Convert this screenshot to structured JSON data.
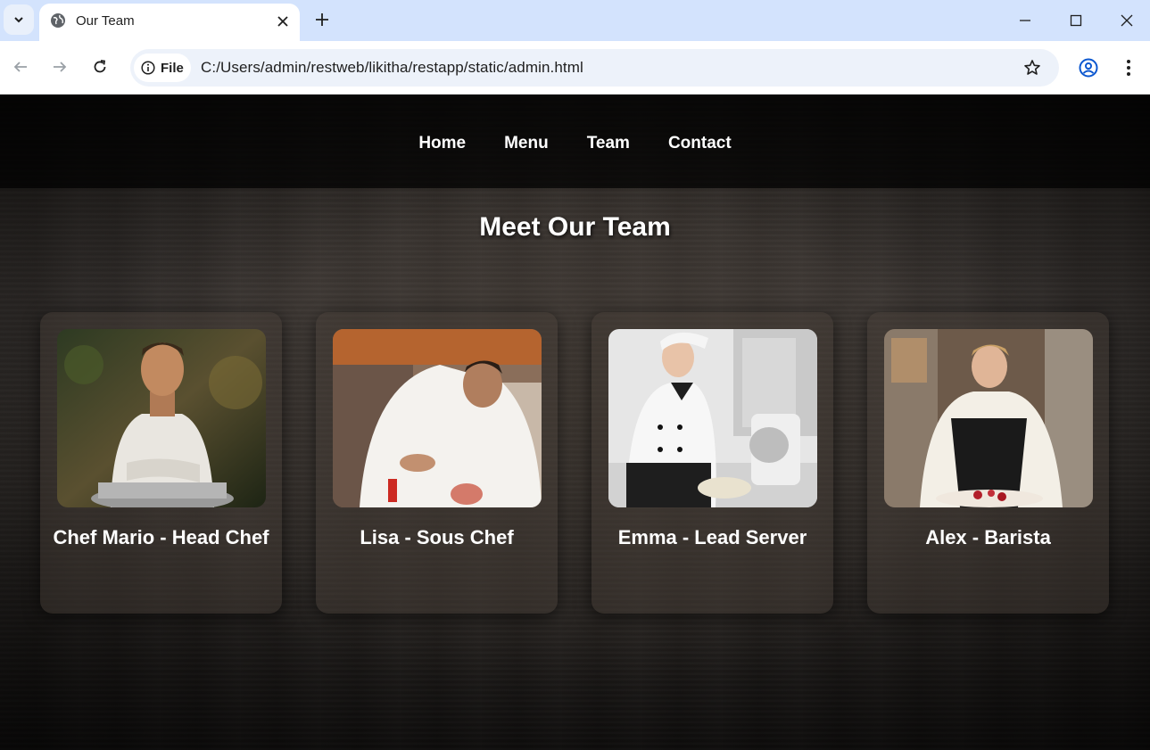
{
  "browser": {
    "tab_title": "Our Team",
    "site_chip_label": "File",
    "url": "C:/Users/admin/restweb/likitha/restapp/static/admin.html"
  },
  "nav": {
    "items": [
      {
        "label": "Home"
      },
      {
        "label": "Menu"
      },
      {
        "label": "Team"
      },
      {
        "label": "Contact"
      }
    ]
  },
  "page": {
    "heading": "Meet Our Team"
  },
  "team": [
    {
      "name": "Chef Mario - Head Chef",
      "photo": "chef-portrait-arms-crossed"
    },
    {
      "name": "Lisa - Sous Chef",
      "photo": "chef-cooking-in-kitchen"
    },
    {
      "name": "Emma - Lead Server",
      "photo": "chef-whisking-at-counter"
    },
    {
      "name": "Alex - Barista",
      "photo": "chef-plating-dish"
    }
  ],
  "colors": {
    "tabstrip": "#d3e3fd",
    "omnibox": "#edf2fa",
    "accent": "#0b57d0",
    "page_text": "#ffffff"
  }
}
